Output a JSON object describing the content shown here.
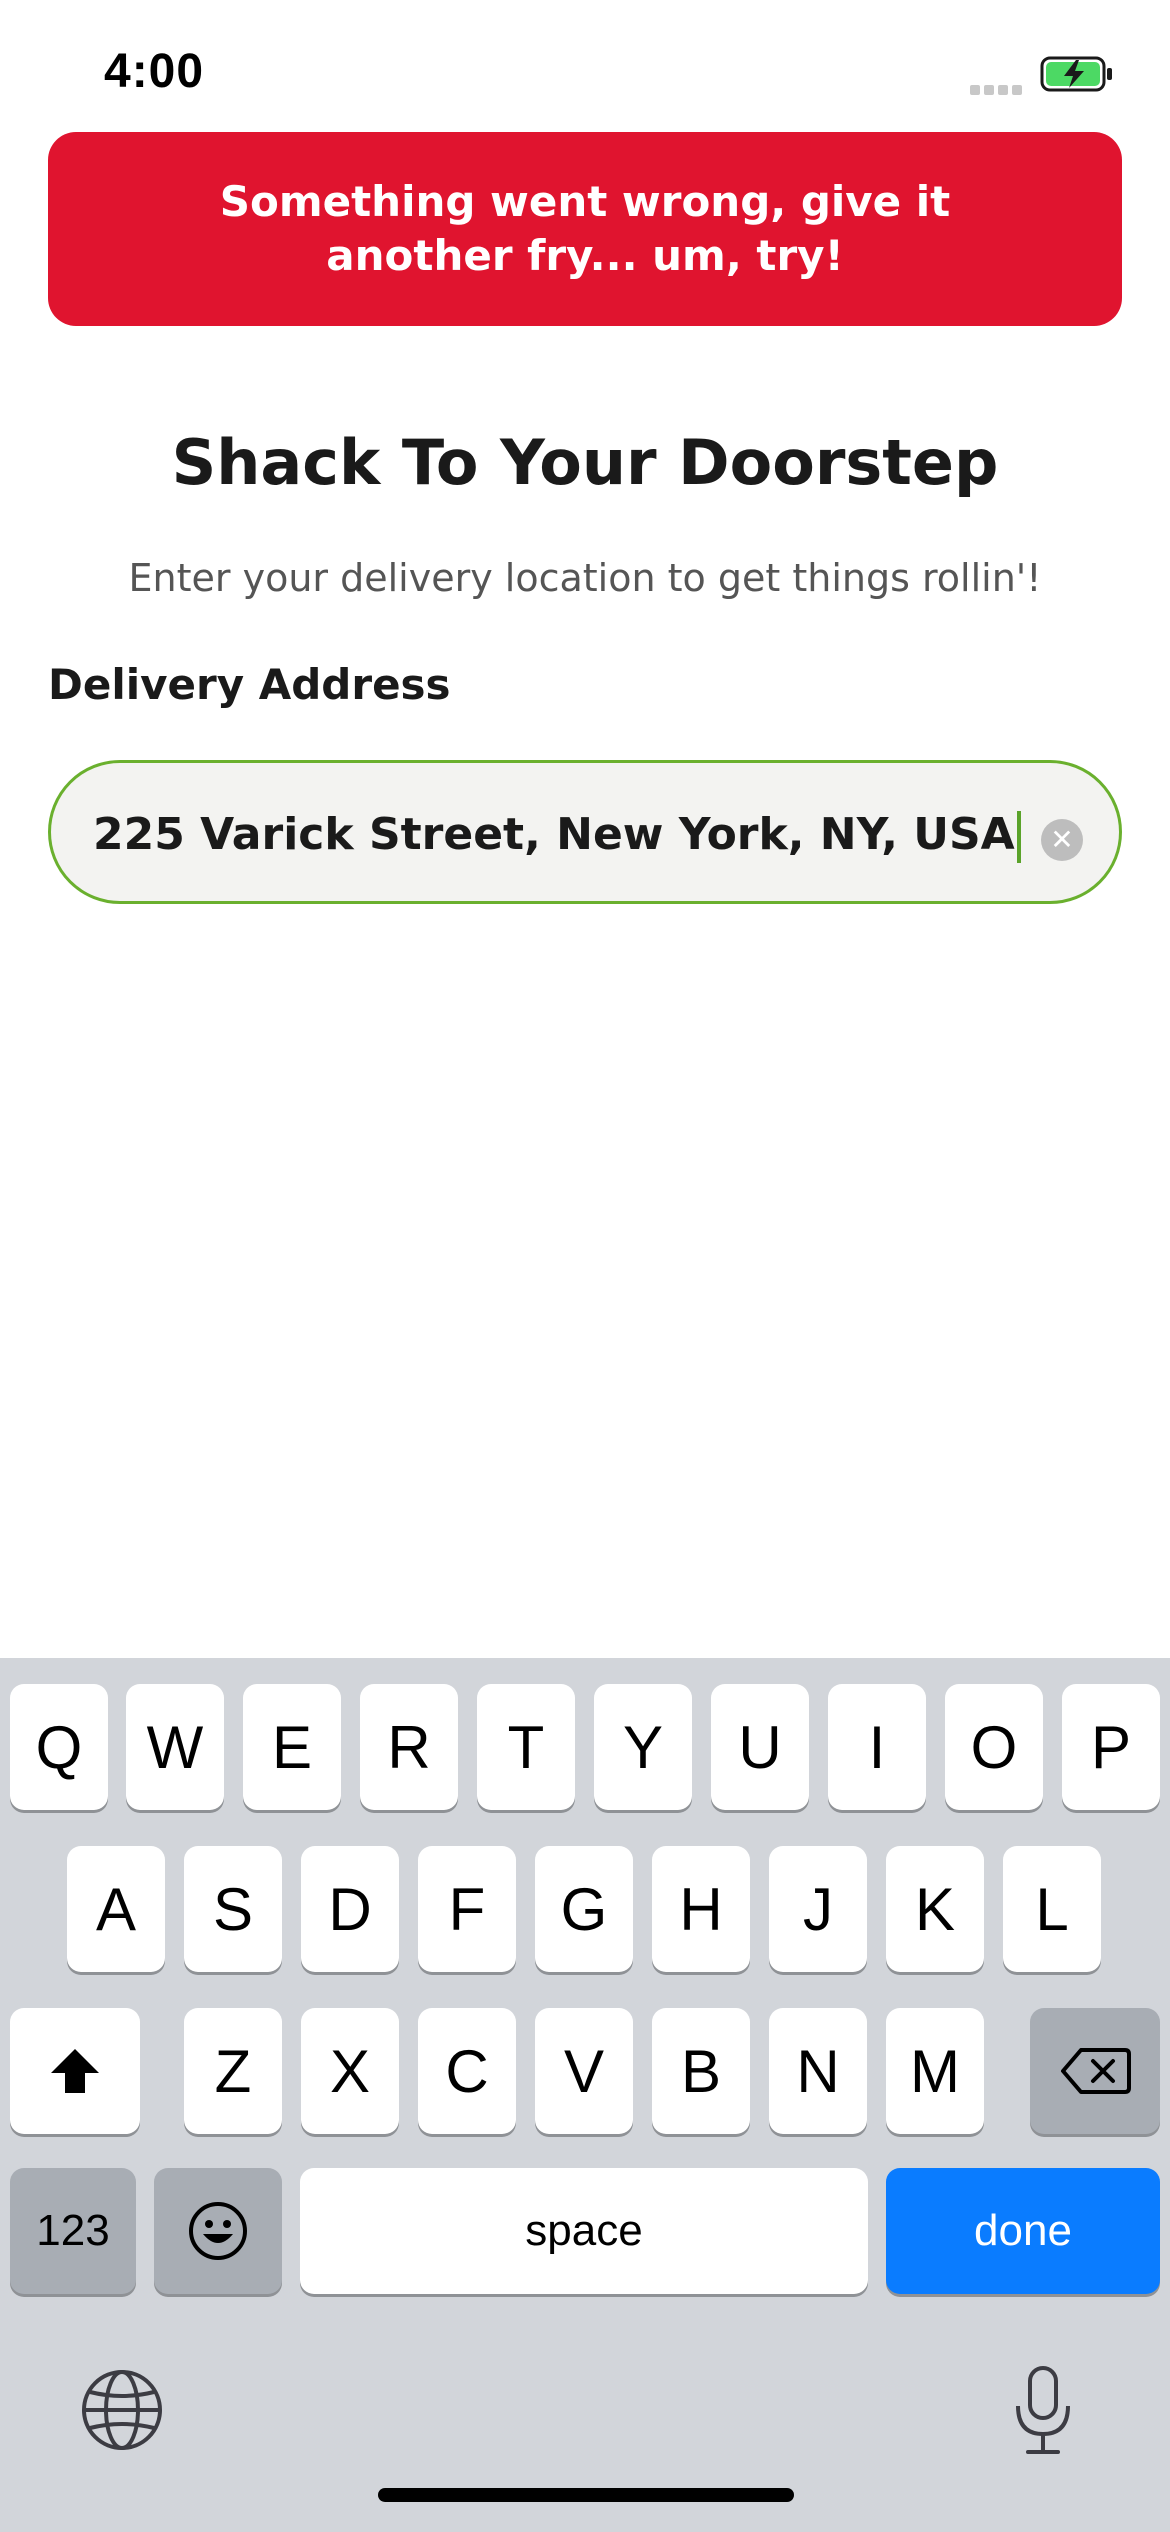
{
  "status_bar": {
    "time": "4:00"
  },
  "banner": {
    "message": "Something went wrong, give it another fry... um, try!"
  },
  "page": {
    "title": "Shack To Your Doorstep",
    "subtitle": "Enter your delivery location to get things rollin'!"
  },
  "address": {
    "label": "Delivery Address",
    "value": "225 Varick Street, New York, NY, USA"
  },
  "keyboard": {
    "row1": [
      "Q",
      "W",
      "E",
      "R",
      "T",
      "Y",
      "U",
      "I",
      "O",
      "P"
    ],
    "row2": [
      "A",
      "S",
      "D",
      "F",
      "G",
      "H",
      "J",
      "K",
      "L"
    ],
    "row3": [
      "Z",
      "X",
      "C",
      "V",
      "B",
      "N",
      "M"
    ],
    "numbers_label": "123",
    "space_label": "space",
    "done_label": "done"
  },
  "icons": {
    "shift": "shift-icon",
    "backspace": "backspace-icon",
    "emoji": "emoji-icon",
    "globe": "globe-icon",
    "mic": "microphone-icon",
    "clear": "clear-icon",
    "battery": "battery-charging-icon",
    "signal": "signal-icon"
  },
  "colors": {
    "banner": "#e0142f",
    "input_border": "#6ab02e",
    "done_key": "#0a7cff",
    "battery": "#4cd964"
  }
}
